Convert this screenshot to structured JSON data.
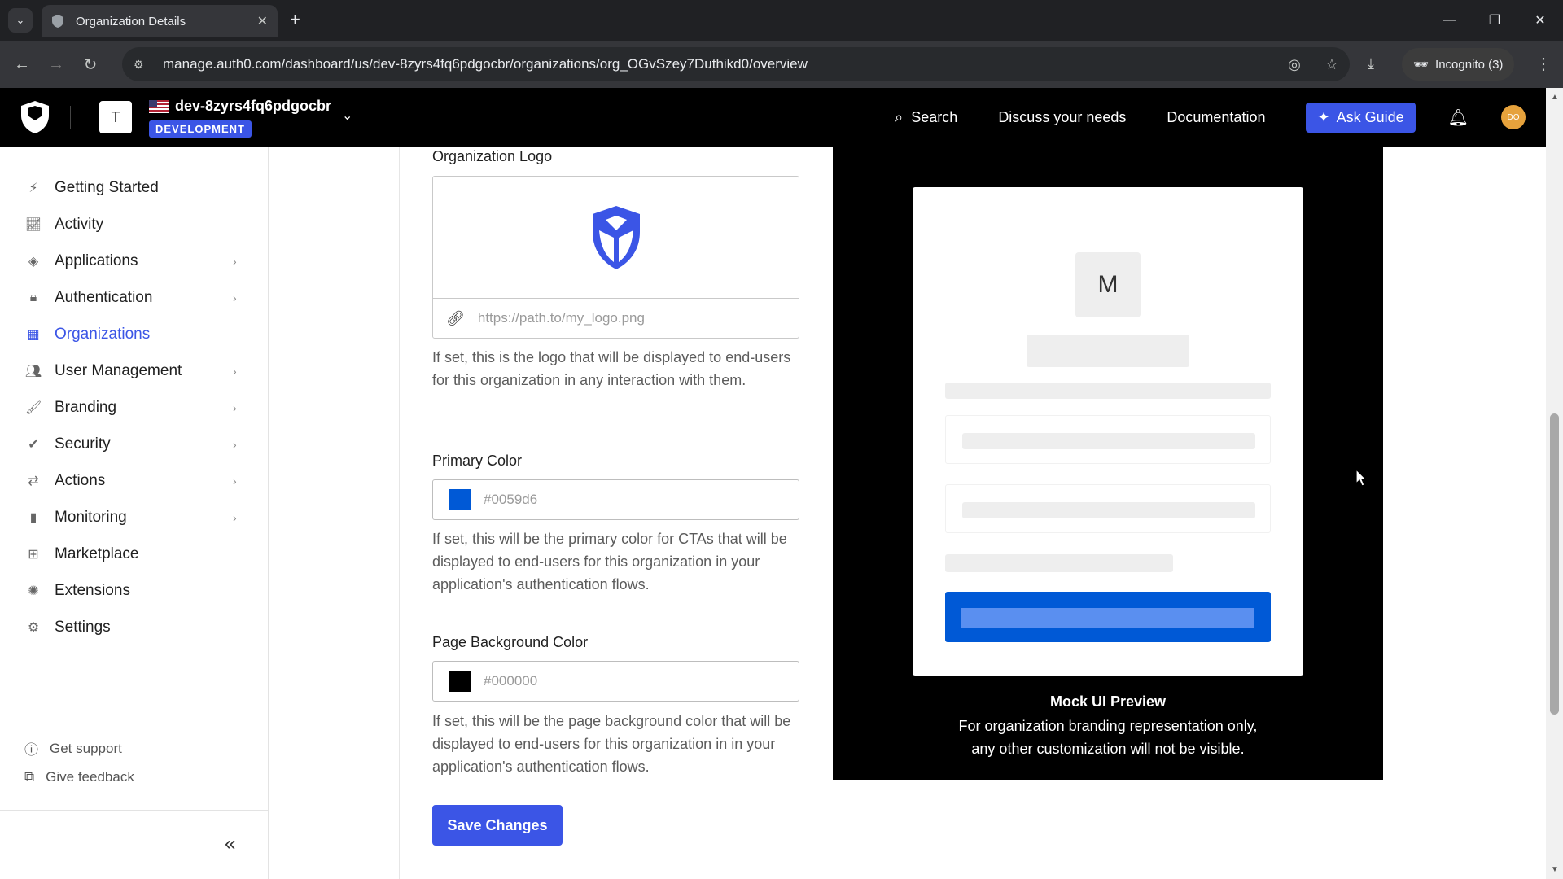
{
  "browser": {
    "tab_title": "Organization Details",
    "url": "manage.auth0.com/dashboard/us/dev-8zyrs4fq6pdgocbr/organizations/org_OGvSzey7Duthikd0/overview",
    "incognito_label": "Incognito (3)"
  },
  "header": {
    "tenant_initial": "T",
    "tenant_name": "dev-8zyrs4fq6pdgocbr",
    "env_badge": "DEVELOPMENT",
    "search": "Search",
    "discuss": "Discuss your needs",
    "docs": "Documentation",
    "ask_guide": "Ask Guide",
    "user_initials": "DO"
  },
  "sidebar": {
    "items": [
      {
        "label": "Getting Started",
        "icon": "bolt-icon"
      },
      {
        "label": "Activity",
        "icon": "chart-icon"
      },
      {
        "label": "Applications",
        "icon": "layers-icon"
      },
      {
        "label": "Authentication",
        "icon": "lock-icon"
      },
      {
        "label": "Organizations",
        "icon": "org-icon"
      },
      {
        "label": "User Management",
        "icon": "users-icon"
      },
      {
        "label": "Branding",
        "icon": "brush-icon"
      },
      {
        "label": "Security",
        "icon": "shield-icon"
      },
      {
        "label": "Actions",
        "icon": "flow-icon"
      },
      {
        "label": "Monitoring",
        "icon": "bars-icon"
      },
      {
        "label": "Marketplace",
        "icon": "grid-plus-icon"
      },
      {
        "label": "Extensions",
        "icon": "puzzle-icon"
      },
      {
        "label": "Settings",
        "icon": "gear-icon"
      }
    ],
    "support": "Get support",
    "feedback": "Give feedback"
  },
  "form": {
    "logo_label": "Organization Logo",
    "logo_placeholder": "https://path.to/my_logo.png",
    "logo_help": "If set, this is the logo that will be displayed to end-users for this organization in any interaction with them.",
    "primary_label": "Primary Color",
    "primary_value": "#0059d6",
    "primary_help": "If set, this will be the primary color for CTAs that will be displayed to end-users for this organization in your application's authentication flows.",
    "bg_label": "Page Background Color",
    "bg_value": "#000000",
    "bg_help": "If set, this will be the page background color that will be displayed to end-users for this organization in in your application's authentication flows.",
    "save": "Save Changes"
  },
  "preview": {
    "logo_letter": "M",
    "title": "Mock UI Preview",
    "subtitle_line1": "For organization branding representation only,",
    "subtitle_line2": "any other customization will not be visible."
  },
  "colors": {
    "accent": "#3b55e6",
    "primary": "#0059d6",
    "page_bg": "#000000"
  }
}
